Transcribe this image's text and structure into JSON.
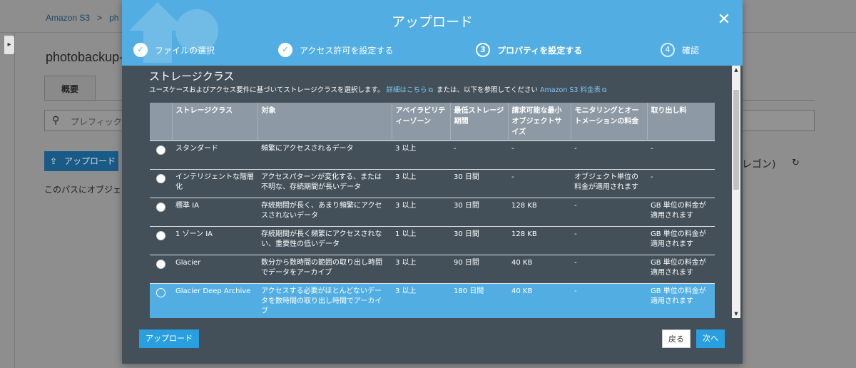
{
  "background": {
    "breadcrumb": [
      "Amazon S3",
      "ph"
    ],
    "breadcrumb_sep": ">",
    "toggle_arrow": "▸",
    "bucket_title": "photobackup-",
    "tab_overview": "概要",
    "search_icon": "⚲",
    "search_placeholder": "プレフィックス",
    "upload_button": "アップロード",
    "upload_icon": "⇪",
    "region_fragment": "レゴン)",
    "refresh_icon": "↻",
    "empty_message": "このパスにオブジェク"
  },
  "modal": {
    "title": "アップロード",
    "close_icon": "✕",
    "steps": [
      {
        "num": "✓",
        "label": "ファイルの選択",
        "state": "done"
      },
      {
        "num": "✓",
        "label": "アクセス許可を設定する",
        "state": "done"
      },
      {
        "num": "3",
        "label": "プロパティを設定する",
        "state": "active"
      },
      {
        "num": "4",
        "label": "確認",
        "state": "inactive"
      }
    ],
    "section_title": "ストレージクラス",
    "section_desc_1": "ユースケースおよびアクセス要件に基づいてストレージクラスを選択します。",
    "details_link": "詳細はこちら",
    "external_icon": "⧉",
    "section_desc_2": "または、以下を参照してください",
    "pricing_link": "Amazon S3 料金表",
    "table": {
      "headers": [
        "",
        "ストレージクラス",
        "対象",
        "アベイラビリティーゾーン",
        "最低ストレージ期間",
        "請求可能な最小オブジェクトサイズ",
        "モニタリングとオートメーションの料金",
        "取り出し料"
      ],
      "rows": [
        {
          "selected": false,
          "cells": [
            "スタンダード",
            "頻繁にアクセスされるデータ",
            "3 以上",
            "-",
            "-",
            "-",
            "-"
          ]
        },
        {
          "selected": false,
          "cells": [
            "インテリジェントな階層化",
            "アクセスパターンが変化する、または不明な、存続期間が長いデータ",
            "3 以上",
            "30 日間",
            "-",
            "オブジェクト単位の料金が適用されます",
            "-"
          ]
        },
        {
          "selected": false,
          "cells": [
            "標準 IA",
            "存続期間が長く、あまり頻繁にアクセスされないデータ",
            "3 以上",
            "30 日間",
            "128 KB",
            "-",
            "GB 単位の料金が適用されます"
          ]
        },
        {
          "selected": false,
          "cells": [
            "1 ゾーン IA",
            "存続期間が長く頻繁にアクセスされない、重要性の低いデータ",
            "1 以上",
            "30 日間",
            "128 KB",
            "-",
            "GB 単位の料金が適用されます"
          ]
        },
        {
          "selected": false,
          "cells": [
            "Glacier",
            "数分から数時間の範囲の取り出し時間でデータをアーカイブ",
            "3 以上",
            "90 日間",
            "40 KB",
            "-",
            "GB 単位の料金が適用されます"
          ]
        },
        {
          "selected": true,
          "cells": [
            "Glacier Deep Archive",
            "アクセスする必要がほとんどないデータを数時間の取り出し時間でアーカイブ",
            "3 以上",
            "180 日間",
            "40 KB",
            "-",
            "GB 単位の料金が適用されます"
          ]
        }
      ]
    },
    "scroll_up": "▲",
    "scroll_down": "▼",
    "footer": {
      "upload_label": "アップロード",
      "back_label": "戻る",
      "next_label": "次へ"
    }
  }
}
